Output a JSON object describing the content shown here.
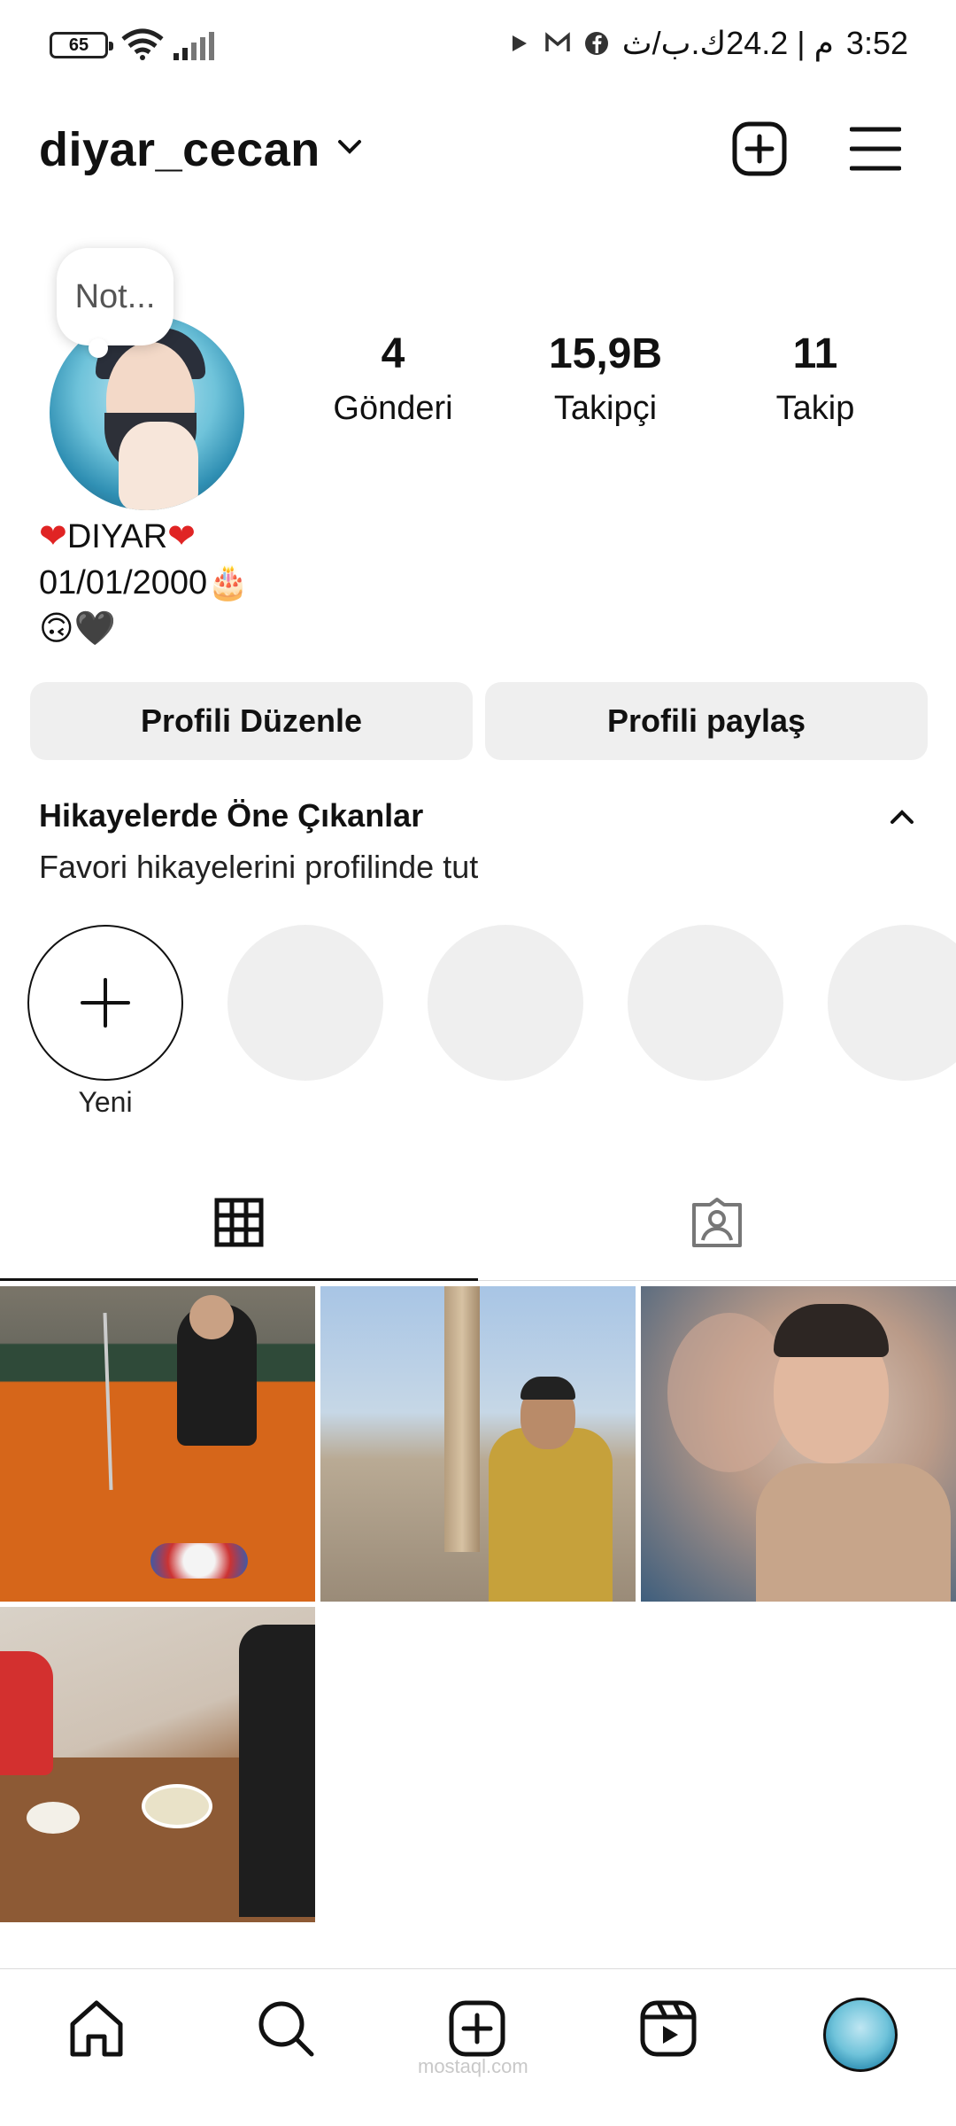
{
  "status_bar": {
    "battery": "65",
    "time": "3:52",
    "right_text": "م | 24.2ك.ب/ث"
  },
  "header": {
    "username": "diyar_cecan"
  },
  "profile": {
    "note": "Not...",
    "stats": [
      {
        "value": "4",
        "label": "Gönderi"
      },
      {
        "value": "15,9B",
        "label": "Takipçi"
      },
      {
        "value": "11",
        "label": "Takip"
      }
    ],
    "bio": {
      "name": "DIYAR",
      "date": "01/01/2000",
      "cake": "🎂",
      "emoji_line": "🙃🖤",
      "heart": "❤"
    }
  },
  "actions": {
    "edit_label": "Profili Düzenle",
    "share_label": "Profili paylaş"
  },
  "highlights": {
    "title": "Hikayelerde Öne Çıkanlar",
    "subtitle": "Favori hikayelerini profilinde tut",
    "new_label": "Yeni",
    "placeholder_count": 4
  },
  "tabs": [
    "grid-posts",
    "tagged"
  ],
  "posts": [
    {
      "subject": "billiards"
    },
    {
      "subject": "tower"
    },
    {
      "subject": "portrait"
    },
    {
      "subject": "dinner"
    }
  ],
  "bottom_nav": [
    "home-icon",
    "search-icon",
    "create-icon",
    "reels-icon",
    "profile-avatar"
  ],
  "watermark": "mostaql.com",
  "colors": {
    "button_bg": "#efefef",
    "text": "#111111",
    "heart": "#e02424",
    "divider": "#dbdbdb"
  }
}
